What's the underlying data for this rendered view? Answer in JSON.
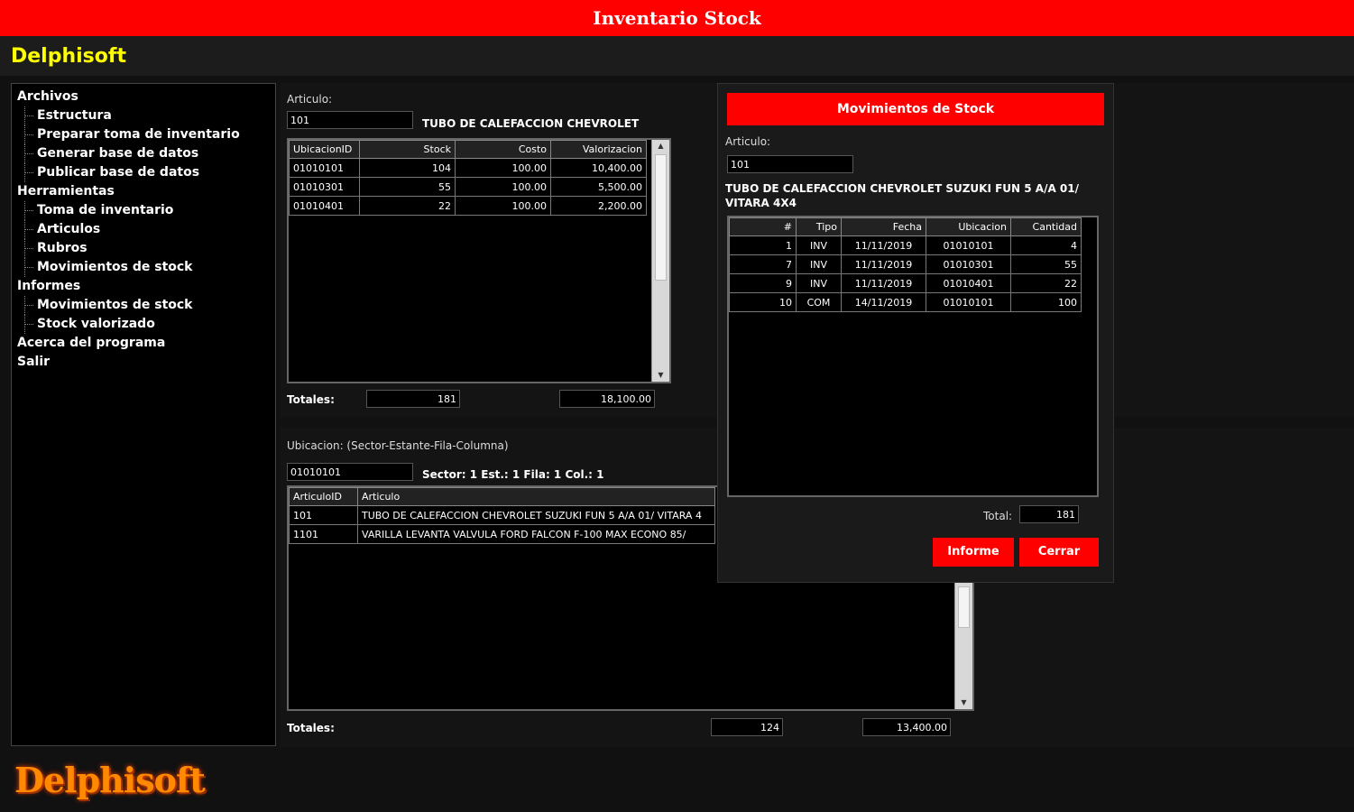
{
  "app": {
    "title": "Inventario Stock",
    "brand": "Delphisoft",
    "footer_logo": "Delphisoft"
  },
  "sidebar": {
    "groups": [
      {
        "label": "Archivos",
        "items": [
          "Estructura",
          "Preparar toma de inventario",
          "Generar base de datos",
          "Publicar base de datos"
        ]
      },
      {
        "label": "Herramientas",
        "items": [
          "Toma de inventario",
          "Articulos",
          "Rubros",
          "Movimientos de stock"
        ]
      },
      {
        "label": "Informes",
        "items": [
          "Movimientos de stock",
          "Stock valorizado"
        ]
      },
      {
        "label": "Acerca del programa",
        "items": []
      },
      {
        "label": "Salir",
        "items": []
      }
    ]
  },
  "articulo_panel": {
    "label": "Articulo:",
    "value": "101",
    "description": "TUBO DE CALEFACCION CHEVROLET",
    "columns": [
      "UbicacionID",
      "Stock",
      "Costo",
      "Valorizacion"
    ],
    "rows": [
      [
        "01010101",
        "104",
        "100.00",
        "10,400.00"
      ],
      [
        "01010301",
        "55",
        "100.00",
        "5,500.00"
      ],
      [
        "01010401",
        "22",
        "100.00",
        "2,200.00"
      ]
    ],
    "totals_label": "Totales:",
    "total_stock": "181",
    "total_valor": "18,100.00"
  },
  "ubicacion_panel": {
    "label": "Ubicacion: (Sector-Estante-Fila-Columna)",
    "value": "01010101",
    "description": "Sector: 1 Est.: 1 Fila: 1 Col.: 1",
    "columns": [
      "ArticuloID",
      "Articulo"
    ],
    "rows": [
      [
        "101",
        "TUBO DE CALEFACCION CHEVROLET SUZUKI FUN 5 A/A 01/ VITARA 4"
      ],
      [
        "1101",
        "VARILLA LEVANTA VALVULA FORD FALCON F-100 MAX ECONO 85/"
      ]
    ],
    "totals_label": "Totales:",
    "total_stock": "124",
    "total_valor": "13,400.00"
  },
  "dialog": {
    "title": "Movimientos de Stock",
    "articulo_label": "Articulo:",
    "articulo_value": "101",
    "description": "TUBO DE CALEFACCION CHEVROLET SUZUKI FUN 5 A/A 01/ VITARA 4X4",
    "columns": [
      "#",
      "Tipo",
      "Fecha",
      "Ubicacion",
      "Cantidad"
    ],
    "rows": [
      [
        "1",
        "INV",
        "11/11/2019",
        "01010101",
        "4"
      ],
      [
        "7",
        "INV",
        "11/11/2019",
        "01010301",
        "55"
      ],
      [
        "9",
        "INV",
        "11/11/2019",
        "01010401",
        "22"
      ],
      [
        "10",
        "COM",
        "14/11/2019",
        "01010101",
        "100"
      ]
    ],
    "total_label": "Total:",
    "total_value": "181",
    "btn_informe": "Informe",
    "btn_cerrar": "Cerrar"
  },
  "colors": {
    "accent": "#ff0000",
    "brand": "#ffff00",
    "logo": "#ff8a00"
  }
}
